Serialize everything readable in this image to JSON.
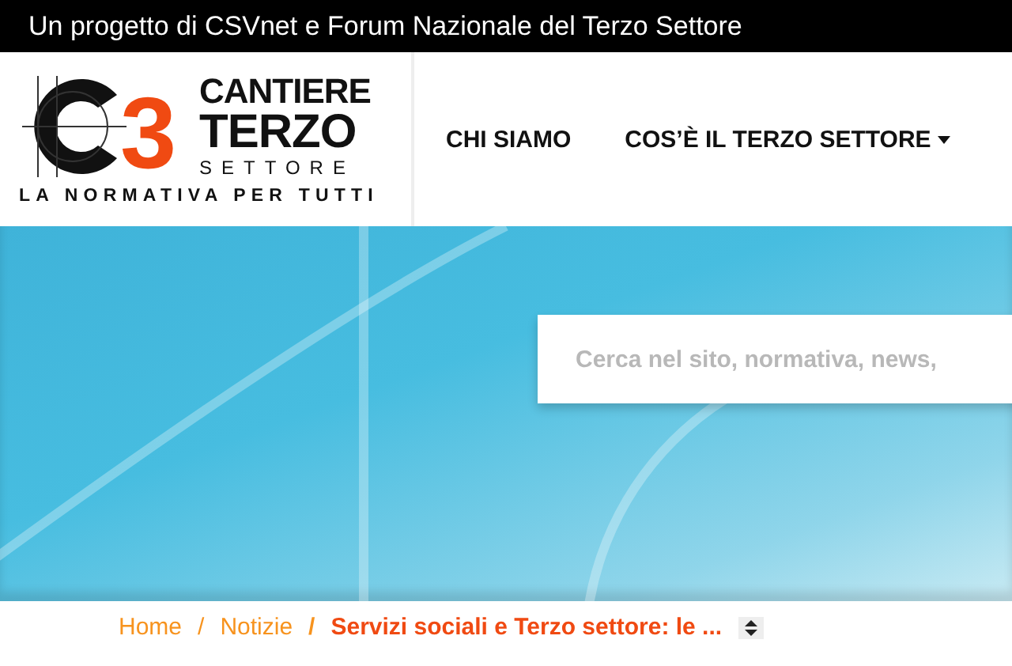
{
  "top_bar": {
    "text": "Un progetto di CSVnet e Forum Nazionale del Terzo Settore"
  },
  "logo": {
    "mark": "3",
    "line_1": "CANTIERE",
    "line_2": "TERZO",
    "line_3": "SETTORE",
    "tagline": "LA NORMATIVA PER TUTTI"
  },
  "nav": [
    {
      "label": "CHI SIAMO",
      "dropdown": false
    },
    {
      "label": "COS’È IL TERZO SETTORE",
      "dropdown": true
    }
  ],
  "search": {
    "placeholder": "Cerca nel sito, normativa, news,"
  },
  "breadcrumb": [
    {
      "label": "Home",
      "current": false
    },
    {
      "label": "Notizie",
      "current": false
    },
    {
      "label": "Servizi sociali e Terzo settore: le ...",
      "current": true
    }
  ],
  "breadcrumb_separator": "/"
}
